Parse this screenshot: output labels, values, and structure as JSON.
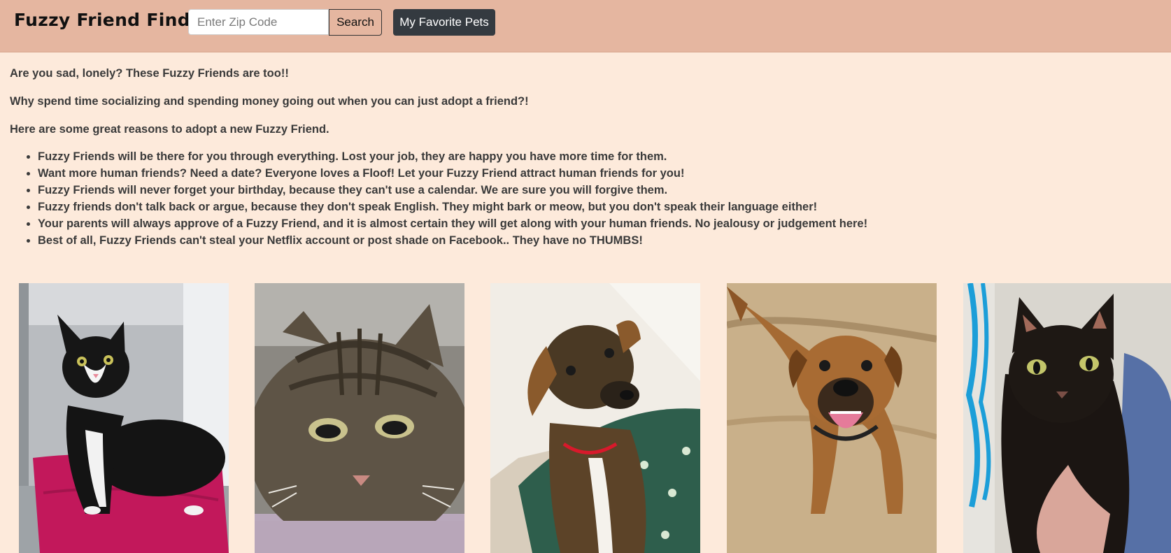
{
  "navbar": {
    "brand": "Fuzzy Friend Finder",
    "zip_placeholder": "Enter Zip Code",
    "zip_value": "",
    "search_label": "Search",
    "favorites_label": "My Favorite Pets"
  },
  "intro": {
    "lines": [
      "Are you sad, lonely? These Fuzzy Friends are too!!",
      "Why spend time socializing and spending money going out when you can just adopt a friend?!",
      "Here are some great reasons to adopt a new Fuzzy Friend."
    ],
    "reasons": [
      "Fuzzy Friends will be there for you through everything. Lost your job, they are happy you have more time for them.",
      "Want more human friends? Need a date? Everyone loves a Floof! Let your Fuzzy Friend attract human friends for you!",
      "Fuzzy Friends will never forget your birthday, because they can't use a calendar. We are sure you will forgive them.",
      "Fuzzy friends don't talk back or argue, because they don't speak English. They might bark or meow, but you don't speak their language either!",
      "Your parents will always approve of a Fuzzy Friend, and it is almost certain they will get along with your human friends. No jealousy or judgement here!",
      "Best of all, Fuzzy Friends can't steal your Netflix account or post shade on Facebook.. They have no THUMBS!"
    ]
  },
  "pets": [
    {
      "animal": "cat",
      "description": "black and white tuxedo cat on pink blanket"
    },
    {
      "animal": "cat",
      "description": "gray tabby cat close-up"
    },
    {
      "animal": "dog",
      "description": "brown and black dog with red collar, head tilted"
    },
    {
      "animal": "dog",
      "description": "tan boxer mix smiling on grass"
    },
    {
      "animal": "cat",
      "description": "black cat held by a person"
    }
  ],
  "colors": {
    "page_background": "#fdeadb",
    "navbar_background": "#e5b6a0",
    "favorites_button": "#343a40",
    "text": "#3a3a3a"
  }
}
